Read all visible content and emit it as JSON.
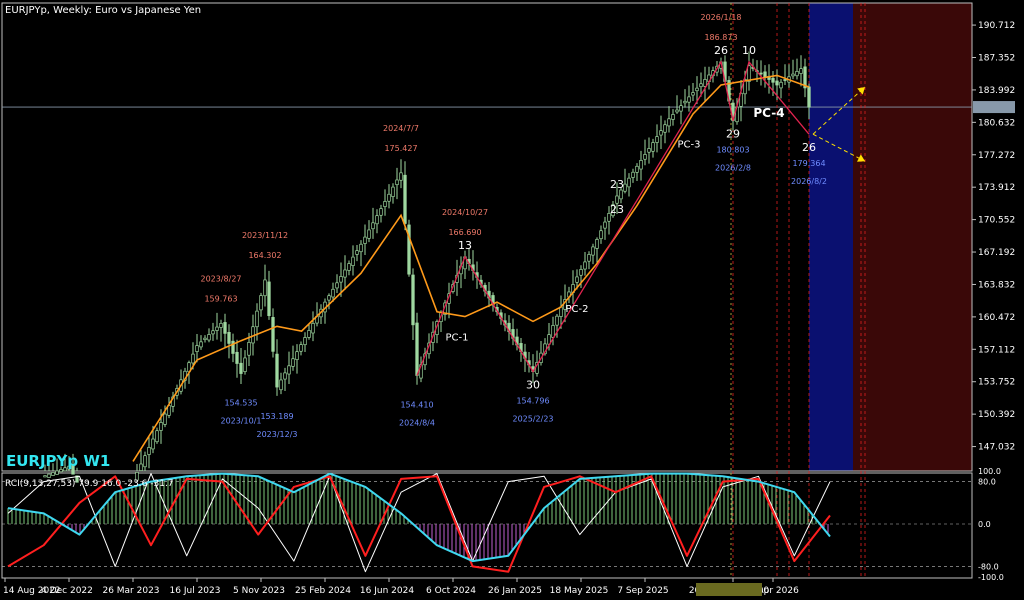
{
  "header": {
    "symbol_line": "EURJPYp, Weekly:  Euro vs Japanese Yen",
    "watermark": "EURJPYp W1"
  },
  "colors": {
    "background": "#000000",
    "candle": "#9fd8a0",
    "ma": "#ff9a1a",
    "zigzag": "#e0234f",
    "top_label": "#f07a6a",
    "bottom_label": "#6f8cff",
    "pivot_label": "#ffffff",
    "navy_zone": "#0a1070",
    "maroon_zone": "#3a0808",
    "rci_fast": "#ffffff",
    "rci_mid": "#ff1f1f",
    "rci_slow": "#3fd8f0",
    "rci_hist_pos": "#7cc77a",
    "rci_hist_neg": "#c060d0"
  },
  "chart_data": [
    {
      "type": "candlestick",
      "timeframe": "Weekly",
      "price_axis_labels": [
        "190.712",
        "187.352",
        "183.992",
        "180.632",
        "177.272",
        "173.912",
        "170.552",
        "167.192",
        "163.832",
        "160.472",
        "157.112",
        "153.752",
        "150.392",
        "147.032"
      ],
      "current_price": "182.216",
      "ylim": [
        144.5,
        193.0
      ],
      "time_axis_labels": [
        "14 Aug 2022",
        "4 Dec 2022",
        "26 Mar 2023",
        "16 Jul 2023",
        "5 Nov 2023",
        "25 Feb 2024",
        "16 Jun 2024",
        "6 Oct 2024",
        "26 Jan 2025",
        "18 May 2025",
        "7 Sep 2025",
        "2026.02.08 00:00",
        "19 Apr 2026"
      ],
      "close_path": [
        {
          "x": "2022-08-14",
          "y": 137.5
        },
        {
          "x": "2022-10-01",
          "y": 143.5
        },
        {
          "x": "2022-12-04",
          "y": 145.0
        },
        {
          "x": "2023-01-15",
          "y": 140.0
        },
        {
          "x": "2023-03-26",
          "y": 143.5
        },
        {
          "x": "2023-05-21",
          "y": 150.4
        },
        {
          "x": "2023-07-16",
          "y": 157.5
        },
        {
          "x": "2023-08-27",
          "y": 159.8
        },
        {
          "x": "2023-10-01",
          "y": 154.6
        },
        {
          "x": "2023-11-12",
          "y": 164.3
        },
        {
          "x": "2023-12-03",
          "y": 153.2
        },
        {
          "x": "2024-02-25",
          "y": 162.0
        },
        {
          "x": "2024-04-28",
          "y": 168.0
        },
        {
          "x": "2024-07-07",
          "y": 175.4
        },
        {
          "x": "2024-08-04",
          "y": 154.4
        },
        {
          "x": "2024-09-08",
          "y": 160.0
        },
        {
          "x": "2024-10-27",
          "y": 166.7
        },
        {
          "x": "2024-12-22",
          "y": 161.0
        },
        {
          "x": "2025-02-23",
          "y": 154.8
        },
        {
          "x": "2025-04-13",
          "y": 161.5
        },
        {
          "x": "2025-06-15",
          "y": 168.5
        },
        {
          "x": "2025-07-20",
          "y": 173.0
        },
        {
          "x": "2025-10-19",
          "y": 181.0
        },
        {
          "x": "2026-01-18",
          "y": 186.9
        },
        {
          "x": "2026-02-08",
          "y": 180.8
        },
        {
          "x": "2026-03-08",
          "y": 186.5
        },
        {
          "x": "2026-04-26",
          "y": 184.5
        },
        {
          "x": "2026-06-07",
          "y": 186.2
        },
        {
          "x": "2026-06-21",
          "y": 182.2
        }
      ],
      "moving_average_path": [
        {
          "x": "2023-03-26",
          "y": 145.5
        },
        {
          "x": "2023-07-16",
          "y": 156.0
        },
        {
          "x": "2023-10-01",
          "y": 158.0
        },
        {
          "x": "2023-12-03",
          "y": 159.5
        },
        {
          "x": "2024-01-15",
          "y": 159.0
        },
        {
          "x": "2024-04-28",
          "y": 165.0
        },
        {
          "x": "2024-07-07",
          "y": 171.0
        },
        {
          "x": "2024-09-08",
          "y": 161.0
        },
        {
          "x": "2024-10-27",
          "y": 160.5
        },
        {
          "x": "2024-12-22",
          "y": 162.0
        },
        {
          "x": "2025-02-23",
          "y": 160.0
        },
        {
          "x": "2025-04-13",
          "y": 161.5
        },
        {
          "x": "2025-06-15",
          "y": 166.0
        },
        {
          "x": "2025-08-24",
          "y": 172.0
        },
        {
          "x": "2025-11-30",
          "y": 181.5
        },
        {
          "x": "2026-01-18",
          "y": 184.5
        },
        {
          "x": "2026-04-26",
          "y": 185.5
        },
        {
          "x": "2026-06-21",
          "y": 184.3
        }
      ],
      "zigzag": [
        {
          "x": "2024-08-04",
          "y": 154.4
        },
        {
          "x": "2024-10-27",
          "y": 166.7
        },
        {
          "x": "2025-02-23",
          "y": 154.8
        },
        {
          "x": "2026-01-18",
          "y": 186.9
        },
        {
          "x": "2026-02-08",
          "y": 180.8
        },
        {
          "x": "2026-03-08",
          "y": 186.9
        },
        {
          "x": "2026-06-21",
          "y": 179.4
        }
      ],
      "pivot_tops": [
        {
          "date": "2023/8/27",
          "price": "159.763",
          "x": "2023-08-27",
          "y": 159.8
        },
        {
          "date": "2023/11/12",
          "price": "164.302",
          "x": "2023-11-12",
          "y": 164.3
        },
        {
          "date": "2024/7/7",
          "price": "175.427",
          "x": "2024-07-07",
          "y": 175.4
        },
        {
          "date": "2024/10/27",
          "price": "166.690",
          "x": "2024-10-27",
          "y": 166.7
        },
        {
          "date": "2026/1/18",
          "price": "186.873",
          "x": "2026-01-18",
          "y": 186.9
        }
      ],
      "pivot_bottoms": [
        {
          "date": "2023/10/1",
          "price": "154.535",
          "x": "2023-10-01",
          "y": 154.6
        },
        {
          "date": "2023/12/3",
          "price": "153.189",
          "x": "2023-12-03",
          "y": 153.2
        },
        {
          "date": "2024/8/4",
          "price": "154.410",
          "x": "2024-08-04",
          "y": 154.4
        },
        {
          "date": "2025/2/23",
          "price": "154.796",
          "x": "2025-02-23",
          "y": 154.8
        },
        {
          "date": "2026/2/8",
          "price": "180.803",
          "x": "2026-02-08",
          "y": 180.8
        },
        {
          "date": "2026/8/2",
          "price": "179.364",
          "x": "2026-06-21",
          "y": 179.4
        }
      ],
      "wave_counts": [
        {
          "label": "13",
          "x": "2024-10-27",
          "y": 166.7,
          "pos": "above"
        },
        {
          "label": "30",
          "x": "2025-02-23",
          "y": 154.8,
          "pos": "below"
        },
        {
          "label": "23",
          "x": "2025-07-20",
          "y": 173.0,
          "pos": "above"
        },
        {
          "label": "23",
          "x": "2025-07-20",
          "y": 173.0,
          "pos": "below"
        },
        {
          "label": "26",
          "x": "2026-01-18",
          "y": 186.9,
          "pos": "above"
        },
        {
          "label": "29",
          "x": "2026-02-08",
          "y": 180.8,
          "pos": "below"
        },
        {
          "label": "10",
          "x": "2026-03-08",
          "y": 186.9,
          "pos": "above"
        },
        {
          "label": "26",
          "x": "2026-06-21",
          "y": 179.4,
          "pos": "below"
        }
      ],
      "phase_cycles": [
        {
          "label": "PC-1",
          "x": "2024-10-13",
          "y": 158.0
        },
        {
          "label": "PC-2",
          "x": "2025-05-11",
          "y": 161.0
        },
        {
          "label": "PC-3",
          "x": "2025-11-23",
          "y": 178.0
        },
        {
          "label": "PC-4",
          "x": "2026-04-12",
          "y": 181.2
        }
      ],
      "cycle_markers_red": [
        "2026-02-08",
        "2026-04-26",
        "2026-05-17",
        "2026-06-21",
        "2026-09-20",
        "2026-09-27"
      ],
      "cycle_markers_yellow": [
        "2026-02-08"
      ],
      "projection_targets": [
        {
          "x": "2026-09-27",
          "y": 184.3
        },
        {
          "x": "2026-09-27",
          "y": 176.6
        }
      ],
      "shaded_zones": [
        {
          "color": "navy",
          "from": "2026-06-21",
          "to": "2026-09-06"
        },
        {
          "color": "maroon",
          "from": "2026-09-06",
          "to": "2027-05-30"
        }
      ]
    },
    {
      "type": "line",
      "title": "RCI(9,13,27,53) 79.9 16.0 -23.6 -31.7",
      "ylim": [
        -100,
        100
      ],
      "axis_labels": [
        "100.0",
        "80.0",
        "0.0",
        "-80.0",
        "-100.0"
      ],
      "series": [
        {
          "name": "RCI 9",
          "values": [
            20,
            80,
            90,
            -80,
            95,
            -60,
            85,
            30,
            -70,
            90,
            -90,
            60,
            95,
            -70,
            80,
            90,
            -20,
            60,
            85,
            -80,
            70,
            90,
            -60,
            79.9
          ]
        },
        {
          "name": "RCI 13",
          "values": [
            -80,
            -40,
            40,
            90,
            -40,
            85,
            80,
            -20,
            70,
            90,
            -60,
            85,
            90,
            -80,
            -90,
            70,
            90,
            60,
            90,
            -60,
            80,
            85,
            -70,
            16.0
          ]
        },
        {
          "name": "RCI 27",
          "values": [
            30,
            20,
            -20,
            60,
            80,
            90,
            95,
            90,
            60,
            95,
            70,
            20,
            -40,
            -70,
            -60,
            30,
            85,
            90,
            95,
            95,
            90,
            80,
            60,
            -23.6
          ]
        },
        {
          "name": "RCI 53",
          "values": [
            10,
            30,
            50,
            60,
            70,
            80,
            85,
            90,
            92,
            90,
            85,
            70,
            40,
            10,
            -20,
            -30,
            0,
            40,
            70,
            85,
            90,
            80,
            40,
            -31.7
          ]
        }
      ]
    }
  ]
}
